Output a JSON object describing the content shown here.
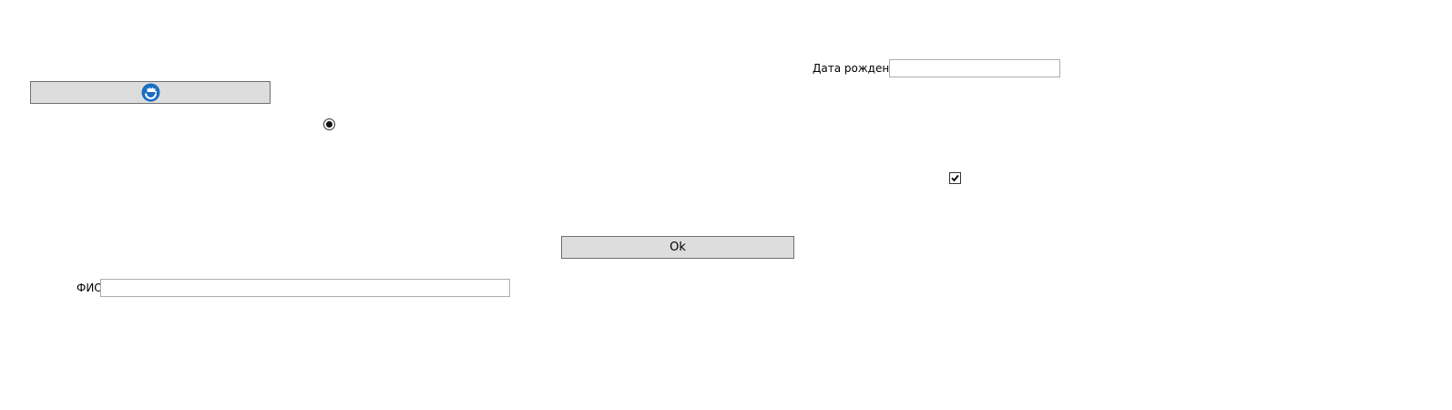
{
  "window": {
    "background": "#ffffff"
  },
  "icon_button": {
    "icon": "refresh-icon",
    "icon_color": "#1a6ec3"
  },
  "radio": {
    "checked": true
  },
  "birth_date": {
    "label": "Дата рождения",
    "value": "",
    "placeholder": ""
  },
  "checkbox": {
    "checked": true
  },
  "ok_button": {
    "label": "Ok"
  },
  "fio": {
    "label": "ФИО",
    "value": "",
    "placeholder": ""
  }
}
